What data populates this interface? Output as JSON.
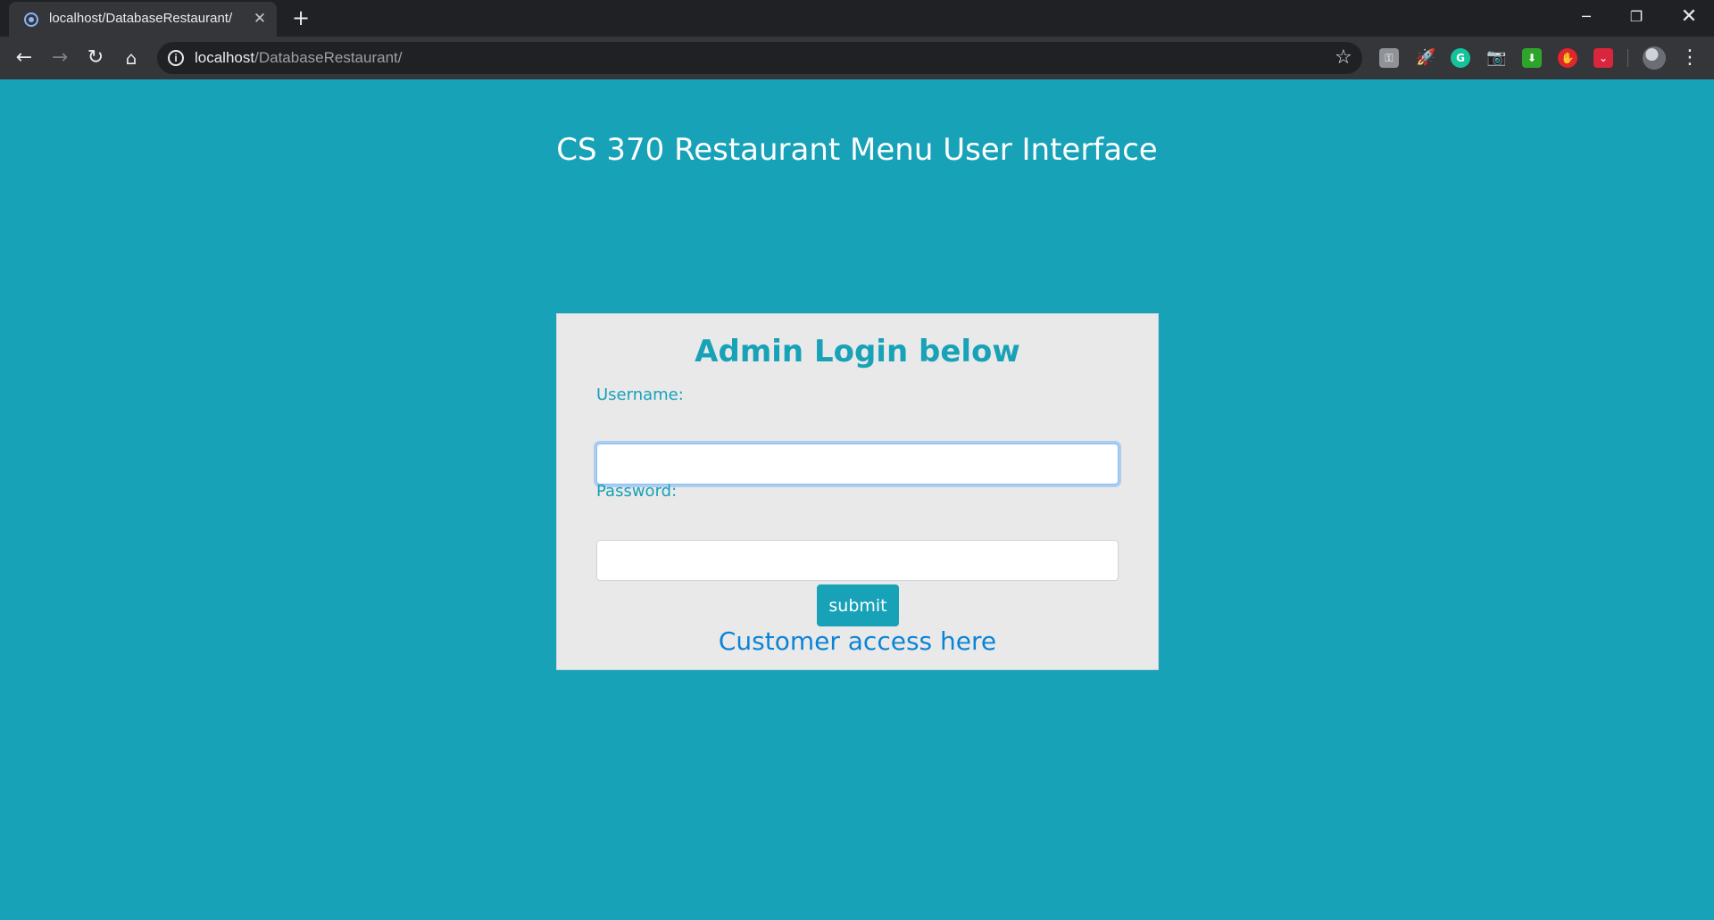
{
  "browser": {
    "tab": {
      "title": "localhost/DatabaseRestaurant/",
      "close_glyph": "✕",
      "favicon": "site-favicon"
    },
    "new_tab_glyph": "+",
    "window_controls": {
      "minimize_glyph": "─",
      "maximize_glyph": "❐",
      "close_glyph": "✕"
    },
    "nav": {
      "back_glyph": "←",
      "forward_glyph": "→",
      "reload_glyph": "↻",
      "home_glyph": "⌂"
    },
    "address": {
      "info_glyph": "i",
      "host": "localhost",
      "path": "/DatabaseRestaurant/",
      "star_glyph": "☆"
    },
    "extensions": [
      {
        "name": "extension-icon",
        "glyph": "⚿"
      },
      {
        "name": "rocket-extension-icon",
        "glyph": "🚀"
      },
      {
        "name": "grammarly-icon",
        "glyph": "G"
      },
      {
        "name": "camera-icon",
        "glyph": "📷"
      },
      {
        "name": "download-extension-icon",
        "glyph": "⬇"
      },
      {
        "name": "adblock-icon",
        "glyph": "✋"
      },
      {
        "name": "pocket-icon",
        "glyph": "⌄"
      }
    ],
    "menu_glyph": "⋮"
  },
  "page": {
    "title": "CS 370 Restaurant Menu User Interface",
    "background_color": "#17a2b8"
  },
  "login": {
    "heading": "Admin Login below",
    "username_label": "Username:",
    "username_value": "",
    "password_label": "Password:",
    "password_value": "",
    "submit_label": "submit",
    "customer_link_text": "Customer access here",
    "accent_color": "#17a2b8",
    "link_color": "#0b84d8",
    "card_color": "#e9e9e9"
  }
}
